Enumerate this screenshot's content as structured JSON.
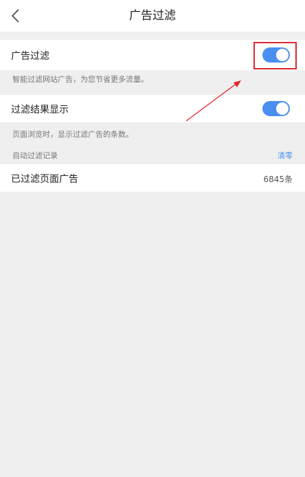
{
  "header": {
    "title": "广告过滤"
  },
  "ad_filter": {
    "label": "广告过滤",
    "enabled": true,
    "hint": "智能过滤网站广告，为您节省更多流量。"
  },
  "result_display": {
    "label": "过滤结果显示",
    "enabled": true,
    "hint": "页面浏览时，显示过滤广告的条数。"
  },
  "auto_record": {
    "section_label": "自动过滤记录",
    "clear_label": "清零"
  },
  "filtered_pages": {
    "label": "已过滤页面广告",
    "count": "6845条"
  },
  "colors": {
    "accent": "#4a8ff0",
    "annotation": "#e0262d",
    "background": "#efefef"
  }
}
